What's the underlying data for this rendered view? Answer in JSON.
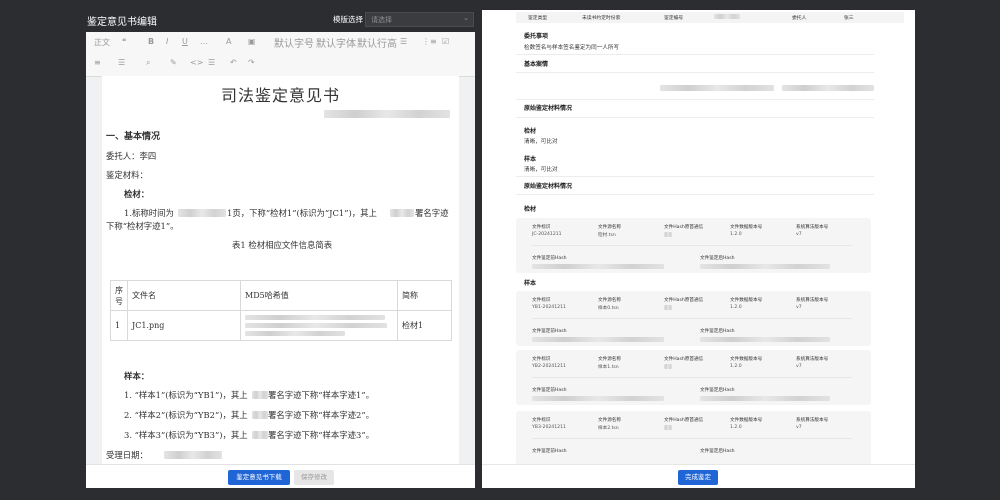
{
  "left": {
    "header_title": "鉴定意见书编辑",
    "template_label": "模版选择",
    "template_placeholder": "请选择",
    "toolbar": {
      "row1": [
        "正文",
        "B",
        "I",
        "U",
        "A",
        "默认字号",
        "默认字体",
        "默认行高"
      ],
      "row1_misc": [
        "…",
        "⋯",
        "▾",
        "▣"
      ],
      "row2": [
        "≡",
        "☰",
        "⌕",
        "✎",
        "<>",
        "☰",
        "↶",
        "↷"
      ]
    },
    "doc": {
      "title": "司法鉴定意见书",
      "sec1": "一、基本情况",
      "client": "委托人：李四",
      "materials": "鉴定材料：",
      "jiancai": "检材：",
      "para1a": "1.标称时间为",
      "para1b": "1页，下称“检材1”(标识为“JC1”)，其上",
      "para1c": "署名字迹",
      "para1d": "下称“检材字迹1”。",
      "table_caption": "表1 检材相应文件信息简表",
      "table_headers": [
        "序号",
        "文件名",
        "MD5哈希值",
        "简称"
      ],
      "table_row": [
        "1",
        "JC1.png",
        "",
        "检材1"
      ],
      "yangben": "样本：",
      "s1a": "1. “样本1”(标识为“YB1”)，其上",
      "s1b": "署名字迹下称“样本字迹1”。",
      "s2a": "2. “样本2”(标识为“YB2”)，其上",
      "s2b": "署名字迹下称“样本字迹2”。",
      "s3a": "3. “样本3”(标识为“YB3”)，其上",
      "s3b": "署名字迹下称“样本字迹3”。",
      "receive_date": "受理日期："
    },
    "download_button": "鉴定意见书下载",
    "save_button": "保存修改"
  },
  "right": {
    "top_row": [
      "鉴定类型",
      "未读书约定时份索",
      "鉴定编号",
      "委托人",
      "张三"
    ],
    "entrust_title": "委托事项",
    "entrust_text": "检数签名与样本签名鉴定为同一人所写",
    "case_title": "基本案情",
    "orig_title": "原始鉴定材料情况",
    "jc_title": "检材",
    "jc_text": "清晰，可比对",
    "yb_title": "样本",
    "yb_text": "清晰，可比对",
    "orig_title2": "原始鉴定材料情况",
    "jc_title2": "检材",
    "yb_title2": "样本",
    "card_keys": [
      "文件标识",
      "文件源名称",
      "文件Hash原首通信",
      "文件数据版本号",
      "系统算法版本号"
    ],
    "card_keys2": [
      "文件鉴定前Hash",
      "文件鉴定后Hash"
    ],
    "cards": [
      {
        "id": "JC-20241211",
        "name": "检材.tsn",
        "ver": "1.2.0",
        "alg": "v7"
      },
      {
        "id": "YB1-20241211",
        "name": "样本0.tsn",
        "ver": "1.2.0",
        "alg": "v7"
      },
      {
        "id": "YB2-20241211",
        "name": "样本1.tsn",
        "ver": "1.2.0",
        "alg": "v7"
      },
      {
        "id": "YB3-20241211",
        "name": "样本2.tsn",
        "ver": "1.2.0",
        "alg": "v7"
      }
    ],
    "done_button": "完成鉴定"
  }
}
